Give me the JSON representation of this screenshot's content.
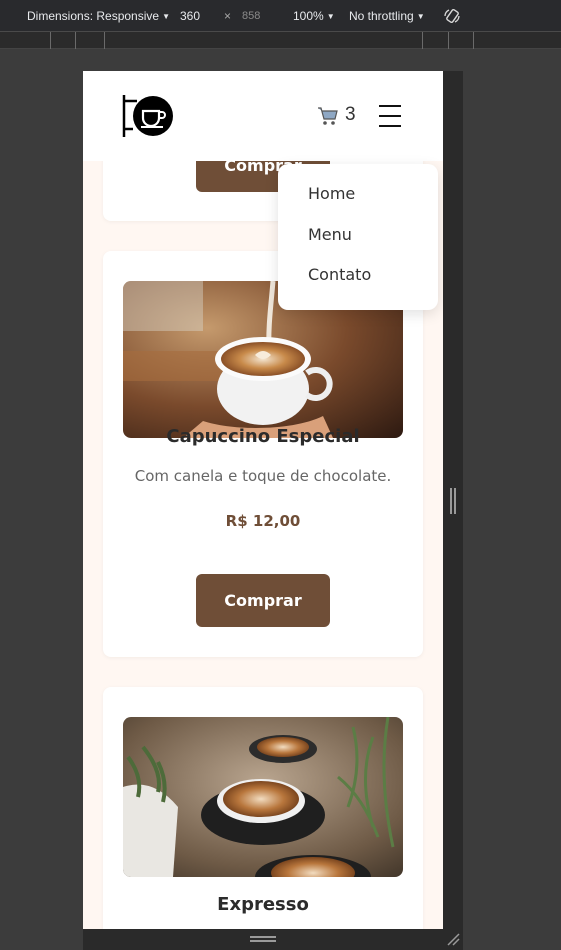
{
  "devtools": {
    "dimensions_label": "Dimensions: Responsive",
    "width": "360",
    "times": "×",
    "height": "858",
    "zoom": "100%",
    "throttling": "No throttling",
    "rotate_icon": "rotate-icon"
  },
  "header": {
    "logo_icon": "coffee-cup-sign-icon",
    "cart_icon": "shopping-cart-icon",
    "cart_count": "3",
    "menu_icon": "hamburger-icon"
  },
  "dropdown": {
    "items": [
      {
        "label": "Home"
      },
      {
        "label": "Menu"
      },
      {
        "label": "Contato"
      }
    ]
  },
  "products": [
    {
      "buy_label": "Comprar"
    },
    {
      "title": "Capuccino Especial",
      "description": "Com canela e toque de chocolate.",
      "price": "R$ 12,00",
      "buy_label": "Comprar"
    },
    {
      "title": "Expresso"
    }
  ],
  "colors": {
    "accent": "#6f4e37",
    "page_bg": "#fff7f2",
    "card_bg": "#ffffff"
  }
}
